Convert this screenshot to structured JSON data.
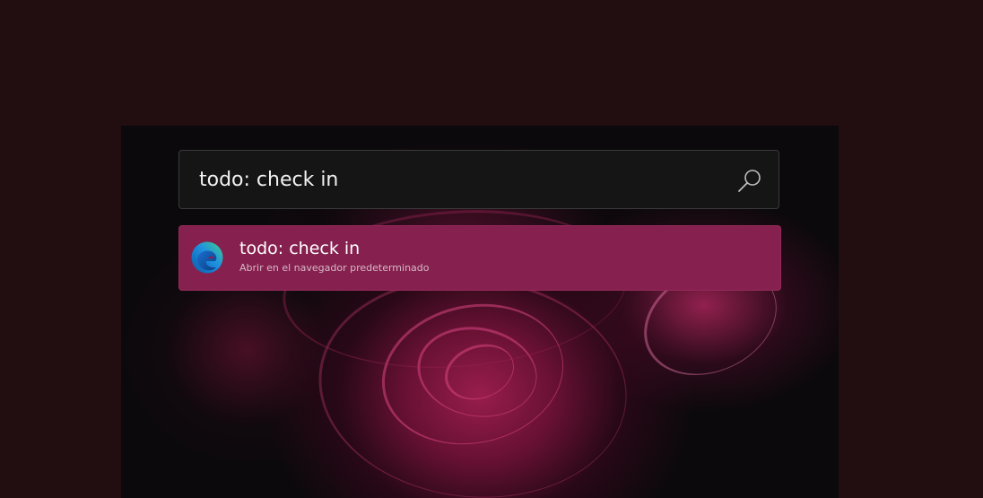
{
  "search": {
    "value": "todo: check in",
    "icon": "search-icon"
  },
  "results": [
    {
      "title": "todo: check in",
      "subtitle": "Abrir en el navegador predeterminado",
      "icon": "edge-browser-icon"
    }
  ],
  "colors": {
    "desktop_background": "#220e10",
    "search_background": "#151515",
    "selected_result": "#86214f",
    "text": "#f2f2f2"
  }
}
